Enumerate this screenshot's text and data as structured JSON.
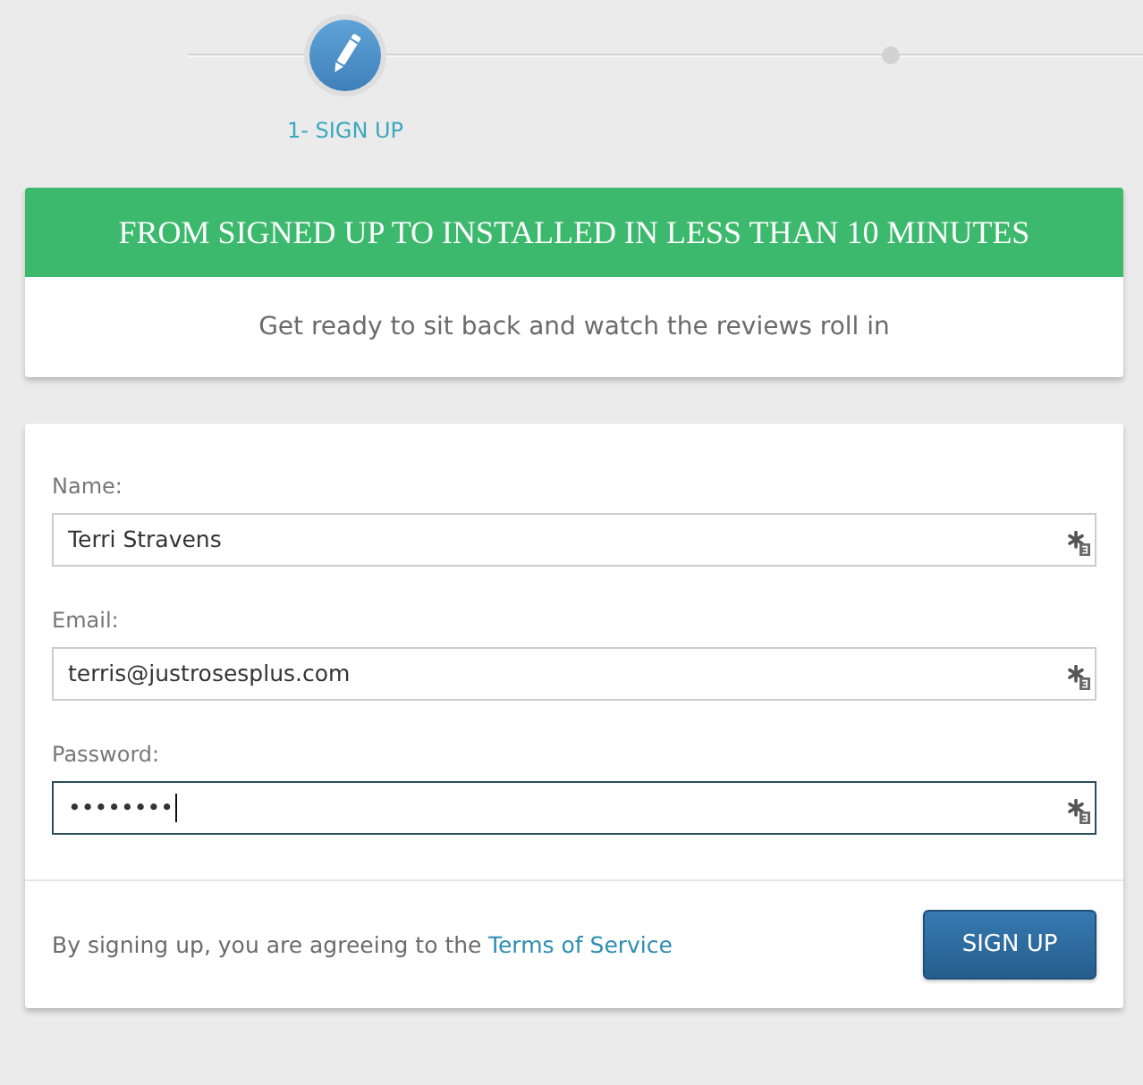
{
  "steps": [
    {
      "label": "1- SIGN UP",
      "selected": true
    },
    {
      "selected": false
    }
  ],
  "banner": {
    "title": "FROM SIGNED UP TO INSTALLED IN LESS THAN 10 MINUTES",
    "subtitle": "Get ready to sit back and watch the reviews roll in"
  },
  "form": {
    "fields": [
      {
        "label": "Name:",
        "value": "Terri Stravens",
        "focused": false
      },
      {
        "label": "Email:",
        "value": "terris@justrosesplus.com",
        "focused": false
      },
      {
        "label": "Password:",
        "value": "••••••••",
        "focused": true
      }
    ]
  },
  "footer": {
    "agreement": "By signing up, you are agreeing to the",
    "terms_link": "Terms of Service",
    "button": "SIGN UP"
  }
}
